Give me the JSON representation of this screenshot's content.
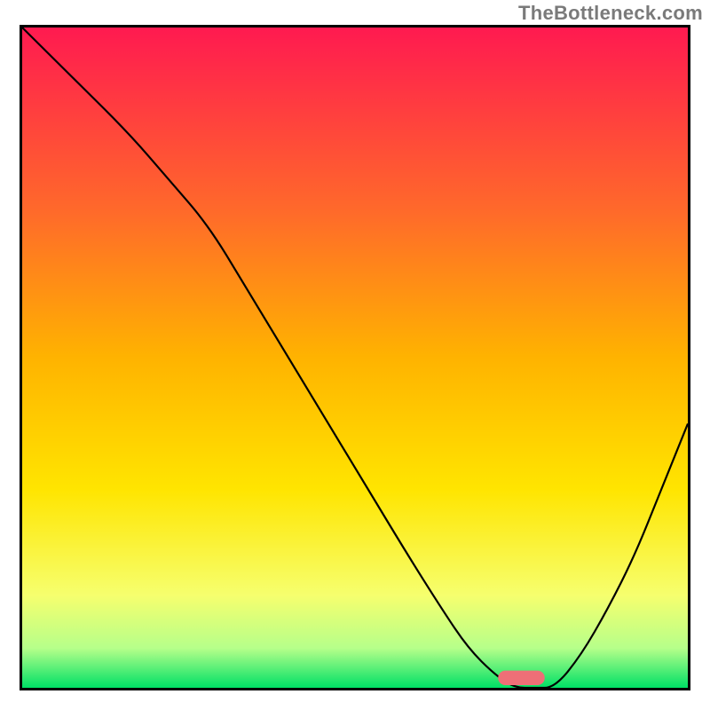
{
  "watermark": "TheBottleneck.com",
  "chart_data": {
    "type": "line",
    "title": "",
    "xlabel": "",
    "ylabel": "",
    "xlim": [
      0,
      100
    ],
    "ylim": [
      0,
      100
    ],
    "grid": false,
    "legend": false,
    "annotations": [],
    "background": {
      "type": "vertical-gradient",
      "stops": [
        {
          "offset": 0.0,
          "color": "#ff1a50"
        },
        {
          "offset": 0.28,
          "color": "#ff6a2a"
        },
        {
          "offset": 0.5,
          "color": "#ffb300"
        },
        {
          "offset": 0.7,
          "color": "#ffe500"
        },
        {
          "offset": 0.86,
          "color": "#f6ff6e"
        },
        {
          "offset": 0.94,
          "color": "#b6ff8a"
        },
        {
          "offset": 1.0,
          "color": "#00e066"
        }
      ]
    },
    "series": [
      {
        "name": "bottleneck-curve",
        "color": "#000000",
        "stroke_width": 2.2,
        "x": [
          0,
          8,
          16,
          22,
          28,
          34,
          40,
          46,
          52,
          58,
          63,
          67,
          71,
          74,
          77,
          80,
          84,
          88,
          92,
          96,
          100
        ],
        "y": [
          100,
          92,
          84,
          77,
          70,
          60,
          50,
          40,
          30,
          20,
          12,
          6,
          2,
          0,
          0,
          0,
          5,
          12,
          20,
          30,
          40
        ]
      }
    ],
    "marker": {
      "shape": "pill",
      "color": "#ee6f77",
      "x_center": 75,
      "y_center": 1.5,
      "width_x": 7,
      "height_y": 2.2
    }
  }
}
